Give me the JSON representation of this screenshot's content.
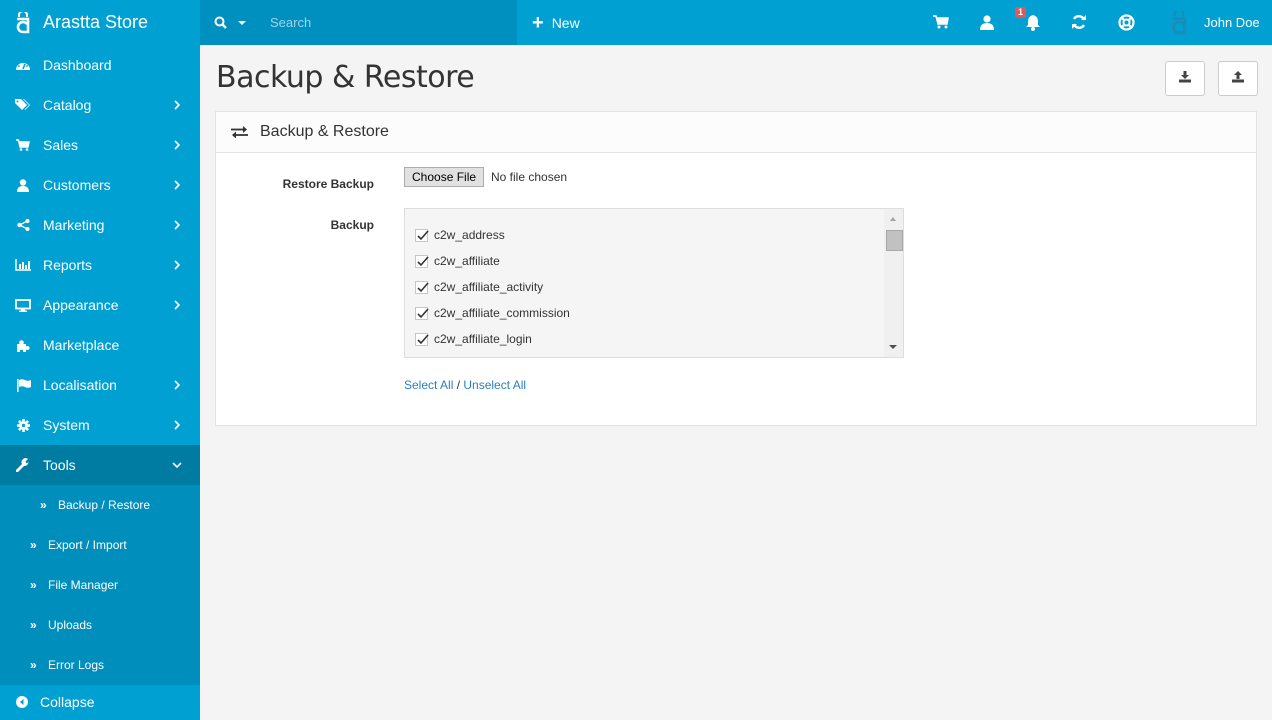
{
  "header": {
    "brand": "Arastta Store",
    "search_placeholder": "Search",
    "new_label": "New",
    "notification_count": "1",
    "user_name": "John Doe"
  },
  "sidebar": {
    "items": [
      {
        "label": "Dashboard",
        "icon": "dashboard-icon",
        "has_children": false
      },
      {
        "label": "Catalog",
        "icon": "tags-icon",
        "has_children": true
      },
      {
        "label": "Sales",
        "icon": "cart-icon",
        "has_children": true
      },
      {
        "label": "Customers",
        "icon": "user-icon",
        "has_children": true
      },
      {
        "label": "Marketing",
        "icon": "share-icon",
        "has_children": true
      },
      {
        "label": "Reports",
        "icon": "bar-chart-icon",
        "has_children": true
      },
      {
        "label": "Appearance",
        "icon": "desktop-icon",
        "has_children": true
      },
      {
        "label": "Marketplace",
        "icon": "puzzle-icon",
        "has_children": false
      },
      {
        "label": "Localisation",
        "icon": "flag-icon",
        "has_children": true
      },
      {
        "label": "System",
        "icon": "gear-icon",
        "has_children": true
      },
      {
        "label": "Tools",
        "icon": "wrench-icon",
        "has_children": true,
        "expanded": true
      }
    ],
    "tools_submenu": [
      {
        "label": "Backup / Restore",
        "current": true
      },
      {
        "label": "Export / Import"
      },
      {
        "label": "File Manager"
      },
      {
        "label": "Uploads"
      },
      {
        "label": "Error Logs"
      }
    ],
    "collapse_label": "Collapse"
  },
  "page": {
    "title": "Backup & Restore",
    "actions": [
      "download-backup",
      "upload-restore"
    ],
    "panel_title": "Backup & Restore",
    "restore_label": "Restore Backup",
    "file_button": "Choose File",
    "file_status": "No file chosen",
    "backup_label": "Backup",
    "tables": [
      {
        "name": "c2w_address",
        "checked": true
      },
      {
        "name": "c2w_affiliate",
        "checked": true
      },
      {
        "name": "c2w_affiliate_activity",
        "checked": true
      },
      {
        "name": "c2w_affiliate_commission",
        "checked": true
      },
      {
        "name": "c2w_affiliate_login",
        "checked": true
      }
    ],
    "select_all": "Select All",
    "separator": " / ",
    "unselect_all": "Unselect All"
  },
  "colors": {
    "primary": "#00a0d2",
    "sidebar_active": "#007ca3",
    "submenu": "#008ebc",
    "link": "#2a7fc1",
    "badge": "#e8545a"
  }
}
